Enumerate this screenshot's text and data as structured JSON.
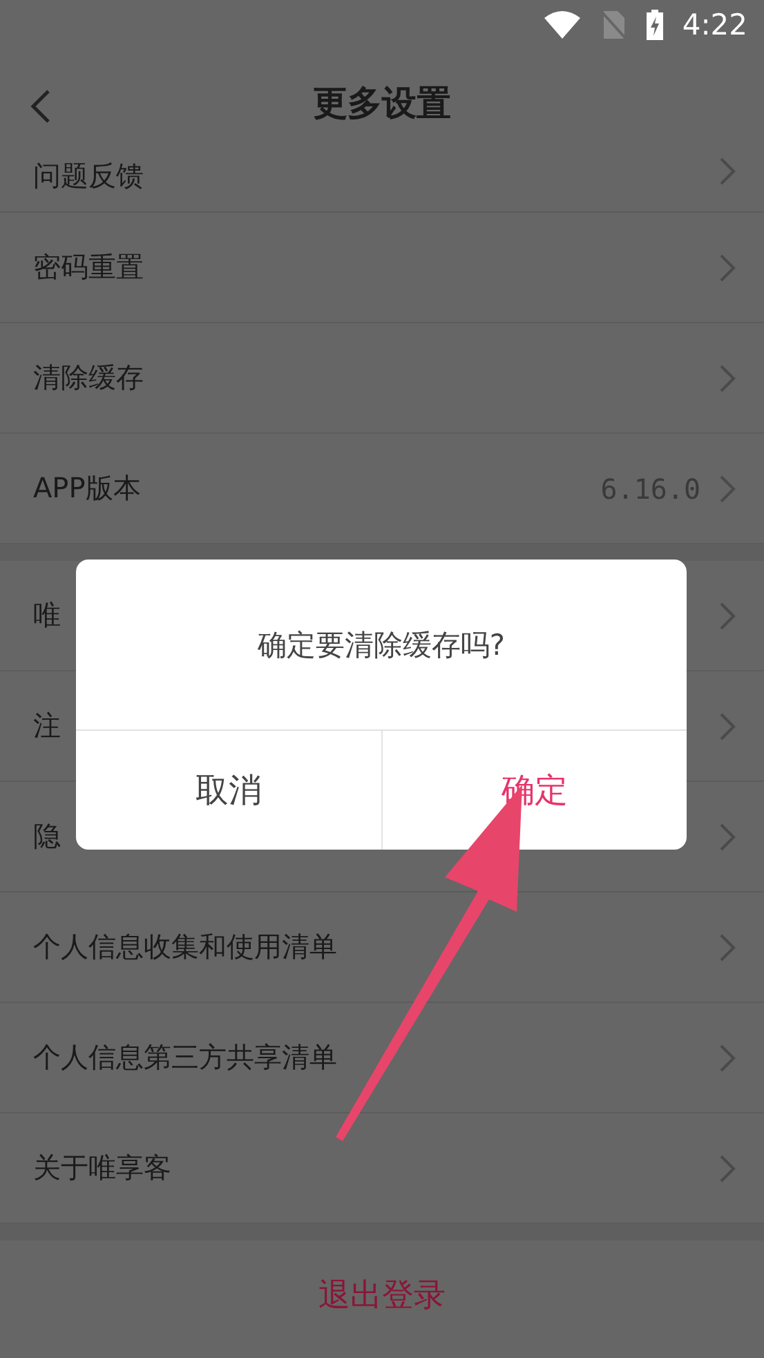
{
  "status_bar": {
    "time": "4:22"
  },
  "header": {
    "title": "更多设置"
  },
  "sections": [
    {
      "rows": [
        {
          "label": "问题反馈",
          "kind": "partial"
        },
        {
          "label": "密码重置"
        },
        {
          "label": "清除缓存"
        },
        {
          "label": "APP版本",
          "value": "6.16.0"
        }
      ]
    },
    {
      "rows": [
        {
          "label": "唯"
        },
        {
          "label": "注"
        },
        {
          "label": "隐"
        },
        {
          "label": "个人信息收集和使用清单"
        },
        {
          "label": "个人信息第三方共享清单"
        },
        {
          "label": "关于唯享客"
        }
      ]
    }
  ],
  "logout_button": "退出登录",
  "dialog": {
    "message": "确定要清除缓存吗?",
    "buttons": [
      {
        "label": "取消",
        "kind": "cancel"
      },
      {
        "label": "确定",
        "kind": "confirm"
      }
    ]
  }
}
